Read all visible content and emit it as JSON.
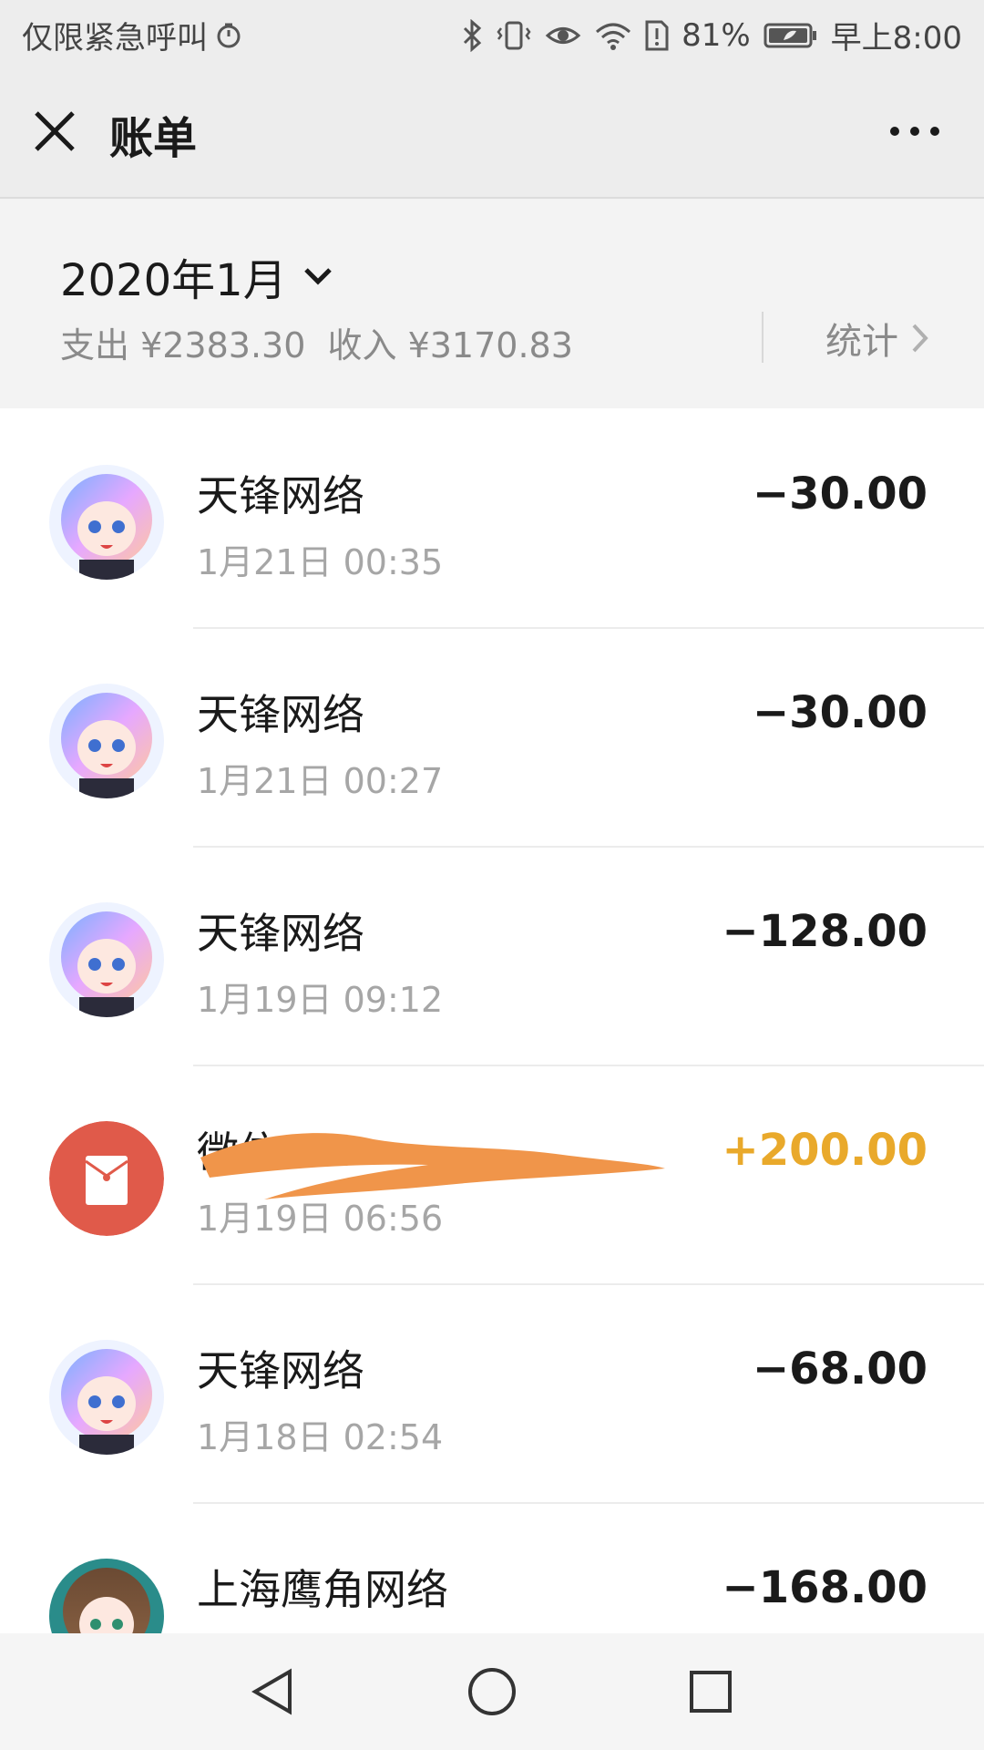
{
  "status_bar": {
    "left_text": "仅限紧急呼叫",
    "battery": "81%",
    "time": "早上8:00"
  },
  "header": {
    "title": "账单",
    "close_icon": "close-icon",
    "more_icon": "more-dots-icon"
  },
  "summary": {
    "month": "2020年1月",
    "expense": "支出 ¥2383.30",
    "income": "收入 ¥3170.83",
    "stats_label": "统计"
  },
  "transactions": [
    {
      "merchant": "天锋网络",
      "time": "1月21日 00:35",
      "amount": "−30.00",
      "type": "expense"
    },
    {
      "merchant": "天锋网络",
      "time": "1月21日 00:27",
      "amount": "−30.00",
      "type": "expense"
    },
    {
      "merchant": "天锋网络",
      "time": "1月19日 09:12",
      "amount": "−128.00",
      "type": "expense"
    },
    {
      "merchant": "微信",
      "time": "1月19日 06:56",
      "amount": "+200.00",
      "type": "income"
    },
    {
      "merchant": "天锋网络",
      "time": "1月18日 02:54",
      "amount": "−68.00",
      "type": "expense"
    },
    {
      "merchant": "上海鹰角网络",
      "time": "",
      "amount": "−168.00",
      "type": "expense"
    }
  ],
  "colors": {
    "income": "#e9a92b",
    "red_packet": "#e05a4a",
    "redaction": "#f0954a"
  }
}
